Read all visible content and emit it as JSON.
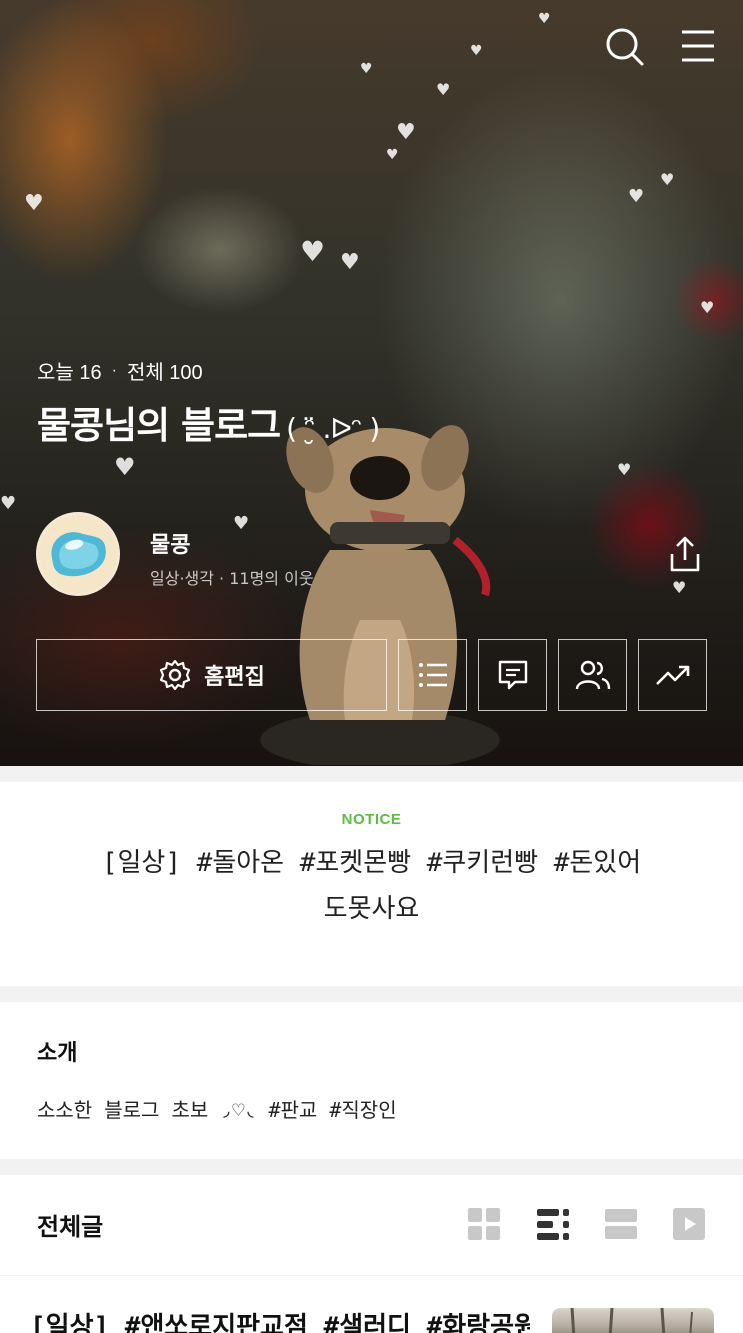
{
  "header": {
    "search_icon": "search-icon",
    "menu_icon": "hamburger-menu-icon"
  },
  "stats": {
    "today_label": "오늘 16",
    "separator": "·",
    "total_label": "전체 100"
  },
  "blog": {
    "title": "물콩님의 블로그",
    "kaomoji": "( ᵔ̮̈ .ᐅᵔ )"
  },
  "owner": {
    "name": "물콩",
    "meta": "일상·생각 · 11명의 이웃"
  },
  "actions": {
    "edit_home_label": "홈편집",
    "icons": [
      "gear-icon",
      "list-icon",
      "comment-icon",
      "neighbors-icon",
      "stats-trend-icon",
      "share-icon"
    ]
  },
  "notice": {
    "label": "NOTICE",
    "text": "[일상] #돌아온 #포켓몬빵 #쿠키런빵 #돈있어도못사요"
  },
  "intro": {
    "title": "소개",
    "text": "소소한 블로그 초보 ◞♡◟ #판교 #직장인"
  },
  "posts": {
    "title": "전체글",
    "view_modes": [
      "grid-view-icon",
      "list-view-icon",
      "card-view-icon",
      "video-view-icon"
    ],
    "selected_view": "list-view-icon",
    "items": [
      {
        "title": "[일상] #앤쏘로지판교점 #샐러디 #화랑공원"
      }
    ]
  },
  "colors": {
    "accent_green": "#5dbb46",
    "section_bg": "#f2f2f2",
    "icon_gray": "#c8c8c8",
    "icon_dark": "#333333"
  }
}
